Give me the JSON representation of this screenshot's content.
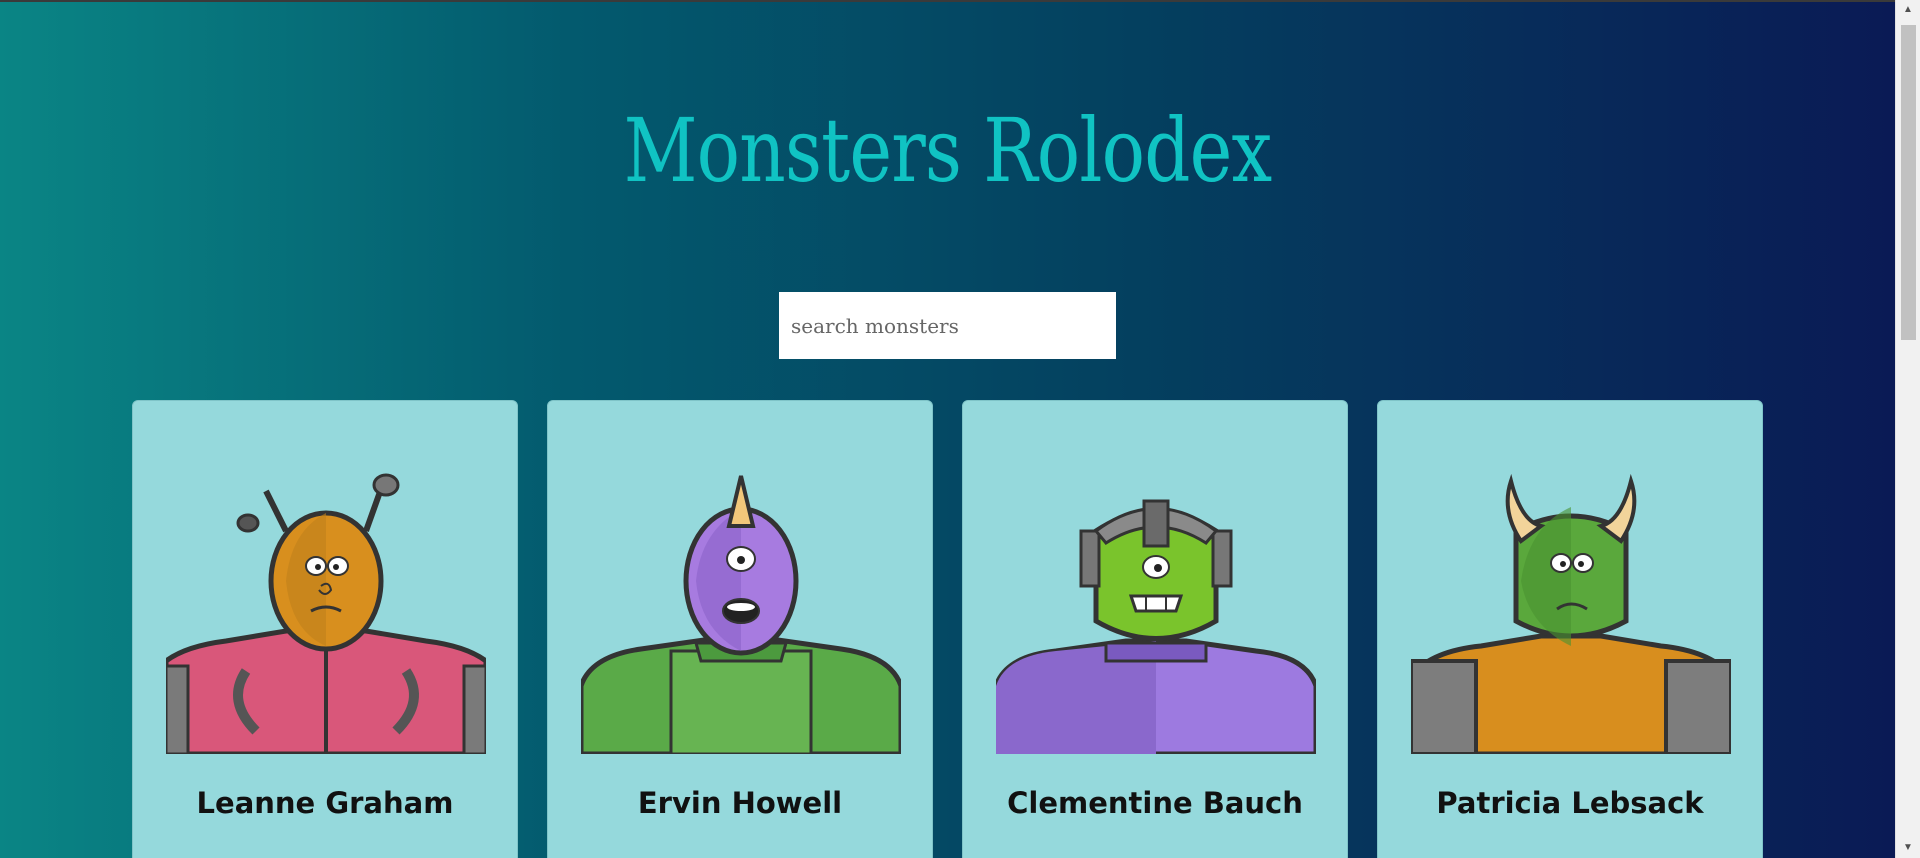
{
  "header": {
    "title": "Monsters Rolodex"
  },
  "search": {
    "placeholder": "search monsters"
  },
  "monsters": [
    {
      "name": "Leanne Graham"
    },
    {
      "name": "Ervin Howell"
    },
    {
      "name": "Clementine Bauch"
    },
    {
      "name": "Patricia Lebsack"
    }
  ],
  "scrollbar": {
    "up_icon": "triangle-up-icon",
    "down_icon": "triangle-down-icon"
  },
  "colors": {
    "title": "#10c3c3",
    "card_background": "#95d9dc",
    "gradient_start": "#0a8585",
    "gradient_end": "#0a1a55"
  }
}
